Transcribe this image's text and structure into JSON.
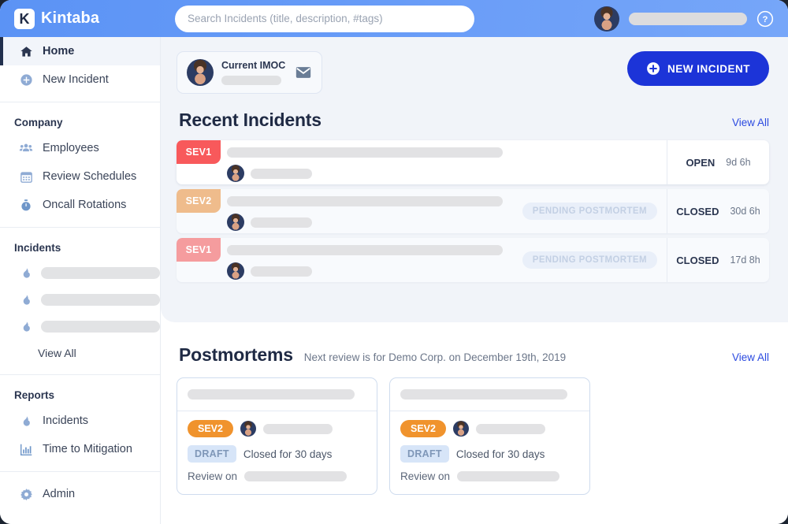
{
  "brand": {
    "name": "Kintaba",
    "logo_letter": "K",
    "logo_icon": "kintaba-logo-icon"
  },
  "colors": {
    "header_blue": "#679bf7",
    "primary_blue": "#1c34d8",
    "link_blue": "#2b4ae0",
    "sev1_bright": "#f8595b",
    "sev1_muted": "#f59c9e",
    "sev2_tan": "#efbc8c",
    "sev2_orange": "#f0932d",
    "draft_blue": "#d7e5f8",
    "panel_bg": "#f1f4f9"
  },
  "search": {
    "placeholder": "Search Incidents (title, description, #tags)",
    "value": ""
  },
  "topbar": {
    "help_icon": "question-mark-circle-icon",
    "user_avatar": "user-avatar",
    "user_name_skeleton": ""
  },
  "sidebar": {
    "home": {
      "label": "Home",
      "icon": "home-icon"
    },
    "new_incident": {
      "label": "New Incident",
      "icon": "plus-circle-icon"
    },
    "company": {
      "group_label": "Company",
      "items": [
        {
          "label": "Employees",
          "icon": "people-icon"
        },
        {
          "label": "Review Schedules",
          "icon": "calendar-icon"
        },
        {
          "label": "Oncall Rotations",
          "icon": "stopwatch-icon"
        }
      ]
    },
    "incidents": {
      "group_label": "Incidents",
      "items": [
        {
          "label": "",
          "icon": "flame-icon"
        },
        {
          "label": "",
          "icon": "flame-icon"
        },
        {
          "label": "",
          "icon": "flame-icon"
        }
      ],
      "view_all": "View All"
    },
    "reports": {
      "group_label": "Reports",
      "items": [
        {
          "label": "Incidents",
          "icon": "flame-icon"
        },
        {
          "label": "Time to Mitigation",
          "icon": "bar-chart-icon"
        }
      ]
    },
    "admin": {
      "label": "Admin",
      "icon": "gear-icon"
    }
  },
  "imoc": {
    "label": "Current IMOC",
    "name_skeleton": "",
    "mail_icon": "envelope-icon"
  },
  "new_incident_button": {
    "label": "NEW INCIDENT",
    "icon": "plus-circle-icon"
  },
  "recent_incidents": {
    "title": "Recent Incidents",
    "view_all": "View All",
    "rows": [
      {
        "sev": "SEV1",
        "sev_color": "#f8595b",
        "state": "open",
        "status": "OPEN",
        "age": "9d 6h",
        "pending": ""
      },
      {
        "sev": "SEV2",
        "sev_color": "#efbc8c",
        "state": "closed",
        "status": "CLOSED",
        "age": "30d 6h",
        "pending": "PENDING POSTMORTEM"
      },
      {
        "sev": "SEV1",
        "sev_color": "#f59c9e",
        "state": "closed",
        "status": "CLOSED",
        "age": "17d 8h",
        "pending": "PENDING POSTMORTEM"
      }
    ]
  },
  "postmortems": {
    "title": "Postmortems",
    "subtitle": "Next review is for Demo Corp. on December 19th, 2019",
    "view_all": "View All",
    "cards": [
      {
        "sev": "SEV2",
        "status": "DRAFT",
        "closed_text": "Closed for 30 days",
        "review_label": "Review on"
      },
      {
        "sev": "SEV2",
        "status": "DRAFT",
        "closed_text": "Closed for 30 days",
        "review_label": "Review on"
      }
    ]
  }
}
